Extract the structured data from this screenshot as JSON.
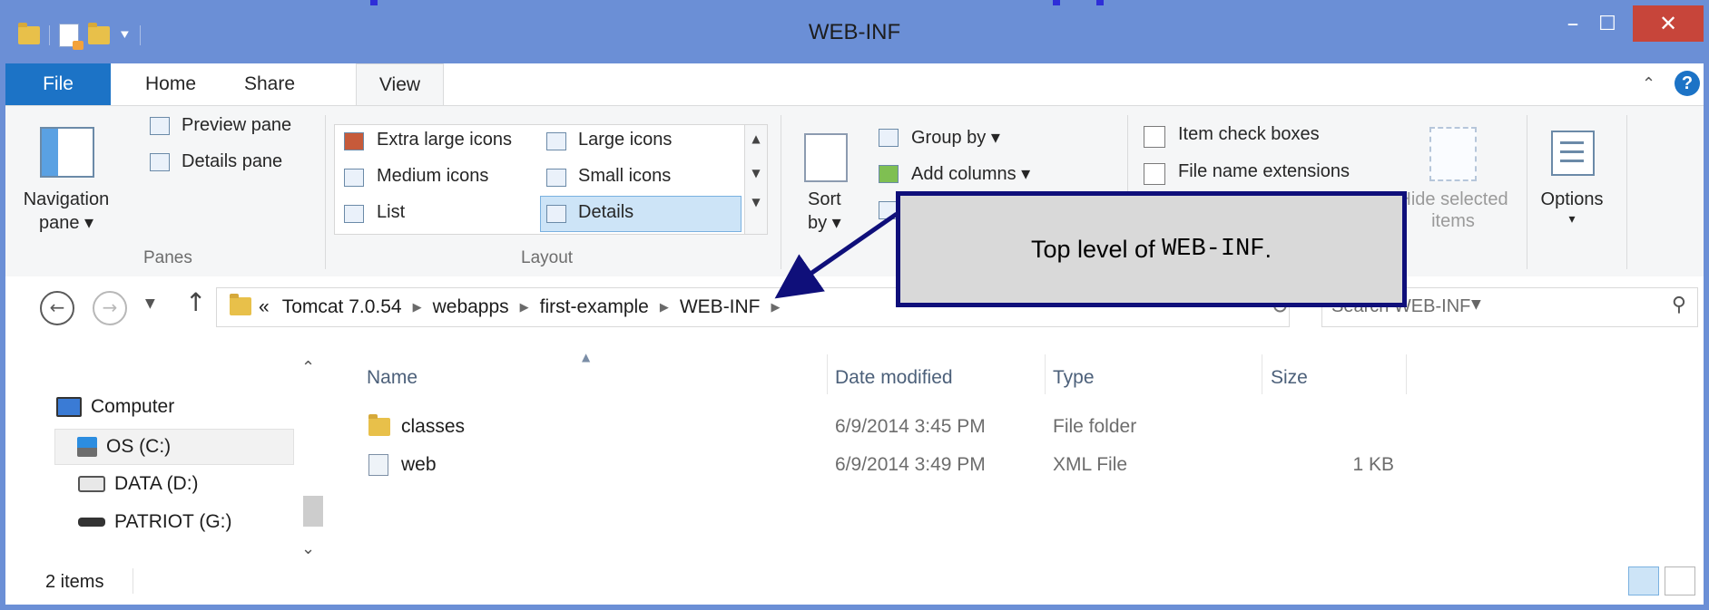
{
  "window": {
    "title": "WEB-INF",
    "min_symbol": "–",
    "max_symbol": "☐",
    "close_symbol": "✕"
  },
  "tabs": {
    "file": "File",
    "home": "Home",
    "share": "Share",
    "view": "View",
    "active": "View",
    "help_symbol": "?"
  },
  "ribbon": {
    "panes": {
      "navigation_pane": "Navigation",
      "navigation_pane_2": "pane ▾",
      "preview_pane": "Preview pane",
      "details_pane": "Details pane",
      "group_label": "Panes"
    },
    "layout": {
      "items": [
        "Extra large icons",
        "Large icons",
        "Medium icons",
        "Small icons",
        "List",
        "Details"
      ],
      "selected": "Details",
      "group_label": "Layout"
    },
    "current_view": {
      "sort_by": "Sort",
      "sort_by_2": "by ▾",
      "group_by": "Group by ▾",
      "add_columns": "Add columns ▾"
    },
    "show_hide": {
      "item_check_boxes": "Item check boxes",
      "file_name_extensions": "File name extensions",
      "hide_selected_items": "Hide selected",
      "hide_selected_items_2": "items",
      "item_check_boxes_checked": false,
      "file_name_extensions_checked": false
    },
    "options": {
      "label": "Options",
      "dropdown": "▾"
    }
  },
  "address": {
    "overflow": "«",
    "crumbs": [
      "Tomcat 7.0.54",
      "webapps",
      "first-example",
      "WEB-INF"
    ],
    "search_placeholder": "Search WEB-INF"
  },
  "nav_pane": {
    "items": [
      "Computer",
      "OS (C:)",
      "DATA (D:)",
      "PATRIOT (G:)"
    ],
    "selected": "OS (C:)"
  },
  "file_list": {
    "columns": [
      "Name",
      "Date modified",
      "Type",
      "Size"
    ],
    "sorted_by": "Name",
    "rows": [
      {
        "name": "classes",
        "date": "6/9/2014 3:45 PM",
        "type": "File folder",
        "size": "",
        "icon": "folder-icon"
      },
      {
        "name": "web",
        "date": "6/9/2014 3:49 PM",
        "type": "XML File",
        "size": "1 KB",
        "icon": "xml-file-icon"
      }
    ]
  },
  "status": {
    "item_count": "2 items"
  },
  "callout": {
    "text_prefix": "Top level of ",
    "text_code": "WEB-INF",
    "text_suffix": "."
  },
  "colors": {
    "title_bar": "#6b8fd6",
    "file_tab": "#1c73c6",
    "close_button": "#c7453a",
    "callout_border": "#0f0f7a",
    "callout_fill": "#d9d9d9"
  }
}
